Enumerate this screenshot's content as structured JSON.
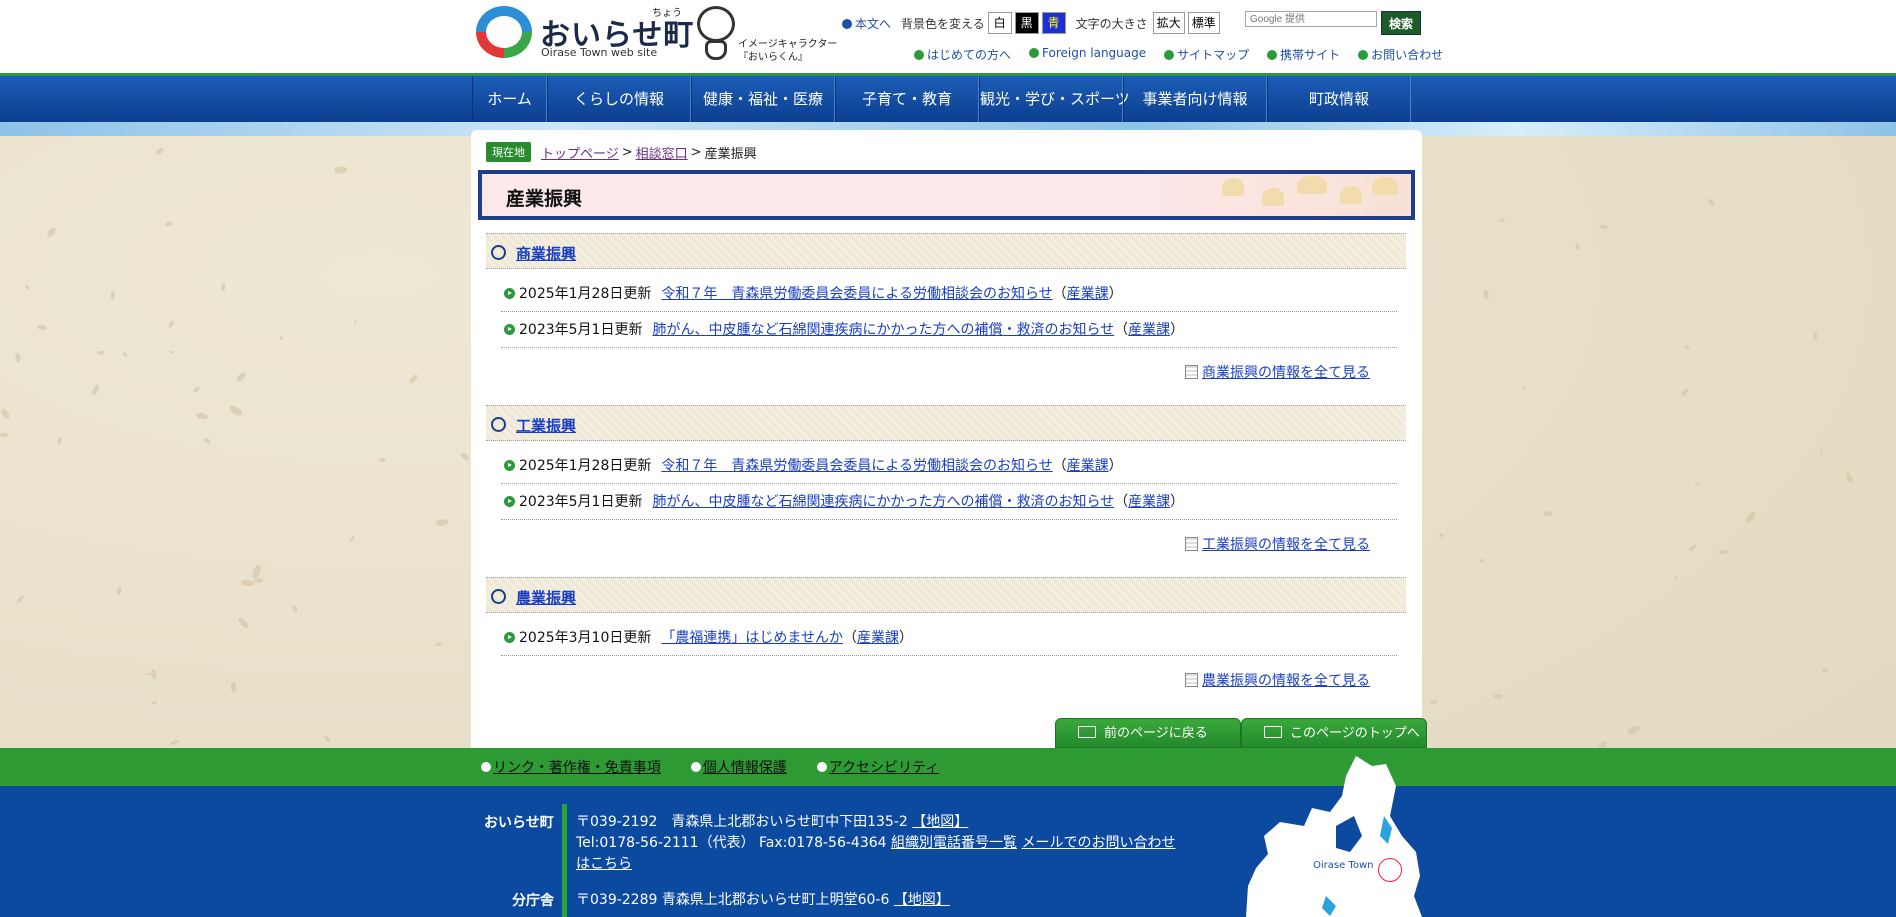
{
  "header": {
    "logo_title": "おいらせ町",
    "logo_ruby": "ちょう",
    "logo_sub": "Oirase Town web site",
    "mascot_label_1": "イメージキャラクター",
    "mascot_label_2": "『おいらくん』",
    "skip_link": "本文へ",
    "bg_label": "背景色を変える",
    "bg_white": "白",
    "bg_black": "黒",
    "bg_blue": "青",
    "font_label": "文字の大きさ",
    "font_large": "拡大",
    "font_standard": "標準",
    "search_placeholder": "Google 提供",
    "search_button": "検索",
    "sublinks": [
      "はじめての方へ",
      "Foreign language",
      "サイトマップ",
      "携帯サイト",
      "お問い合わせ"
    ]
  },
  "gnav": [
    "ホーム",
    "くらしの情報",
    "健康・福祉・医療",
    "子育て・教育",
    "観光・学び・スポーツ",
    "事業者向け情報",
    "町政情報"
  ],
  "breadcrumb": {
    "badge": "現在地",
    "top": "トップページ",
    "parent": "相談窓口",
    "current": "産業振興",
    "sep": ">"
  },
  "page_title": "産業振興",
  "sections": [
    {
      "title": "商業振興",
      "items": [
        {
          "date": "2025年1月28日更新",
          "title": "令和７年　青森県労働委員会委員による労働相談会のお知らせ",
          "dept": "産業課"
        },
        {
          "date": "2023年5月1日更新",
          "title": "肺がん、中皮腫など石綿関連疾病にかかった方への補償・救済のお知らせ",
          "dept": "産業課"
        }
      ],
      "more": "商業振興の情報を全て見る"
    },
    {
      "title": "工業振興",
      "items": [
        {
          "date": "2025年1月28日更新",
          "title": "令和７年　青森県労働委員会委員による労働相談会のお知らせ",
          "dept": "産業課"
        },
        {
          "date": "2023年5月1日更新",
          "title": "肺がん、中皮腫など石綿関連疾病にかかった方への補償・救済のお知らせ",
          "dept": "産業課"
        }
      ],
      "more": "工業振興の情報を全て見る"
    },
    {
      "title": "農業振興",
      "items": [
        {
          "date": "2025年3月10日更新",
          "title": "「農福連携」はじめませんか",
          "dept": "産業課"
        }
      ],
      "more": "農業振興の情報を全て見る"
    }
  ],
  "paren_open": "（",
  "paren_close": "）",
  "page_tabs": {
    "back": "前のページに戻る",
    "top": "このページのトップへ"
  },
  "footer_links": [
    "リンク・著作権・免責事項",
    "個人情報保護",
    "アクセシビリティ"
  ],
  "footer": {
    "town_name": "おいらせ町",
    "address": "〒039-2192　青森県上北郡おいらせ町中下田135-2",
    "map_link": "【地図】",
    "tel": "Tel:0178-56-2111（代表）  Fax:0178-56-4364",
    "dir_link": "組織別電話番号一覧",
    "mail_link": "メールでのお問い合わせはこちら",
    "branch_name": "分庁舎",
    "branch_address": "〒039-2289 青森県上北郡おいらせ町上明堂60-6",
    "branch_map_link": "【地図】",
    "map_label": "Oirase Town"
  },
  "colors": {
    "nav": "#0c4aa0",
    "green": "#2a9a3a",
    "title_border": "#1e3e8c"
  }
}
